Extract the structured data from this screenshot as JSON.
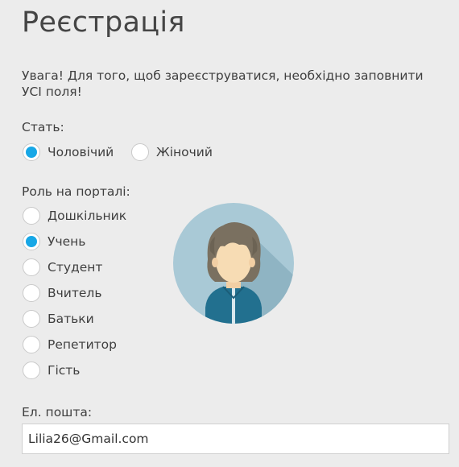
{
  "page": {
    "title": "Реєстрація"
  },
  "notice": "Увага! Для того, щоб зареєструватися, необхідно заповнити УСІ поля!",
  "gender": {
    "label": "Стать:",
    "options": [
      {
        "label": "Чоловічий",
        "checked": true
      },
      {
        "label": "Жіночий",
        "checked": false
      }
    ]
  },
  "role": {
    "label": "Роль на порталі:",
    "options": [
      {
        "label": "Дошкільник",
        "checked": false
      },
      {
        "label": "Учень",
        "checked": true
      },
      {
        "label": "Студент",
        "checked": false
      },
      {
        "label": "Вчитель",
        "checked": false
      },
      {
        "label": "Батьки",
        "checked": false
      },
      {
        "label": "Репетитор",
        "checked": false
      },
      {
        "label": "Гість",
        "checked": false
      }
    ]
  },
  "email": {
    "label": "Ел. пошта:",
    "value": "Lilia26@Gmail.com"
  },
  "colors": {
    "accent": "#17a7e6",
    "background": "#ececec",
    "avatar_bg": "#a9c9d6",
    "jacket": "#22708f"
  },
  "avatar": {
    "icon": "user-avatar-boy-icon"
  }
}
